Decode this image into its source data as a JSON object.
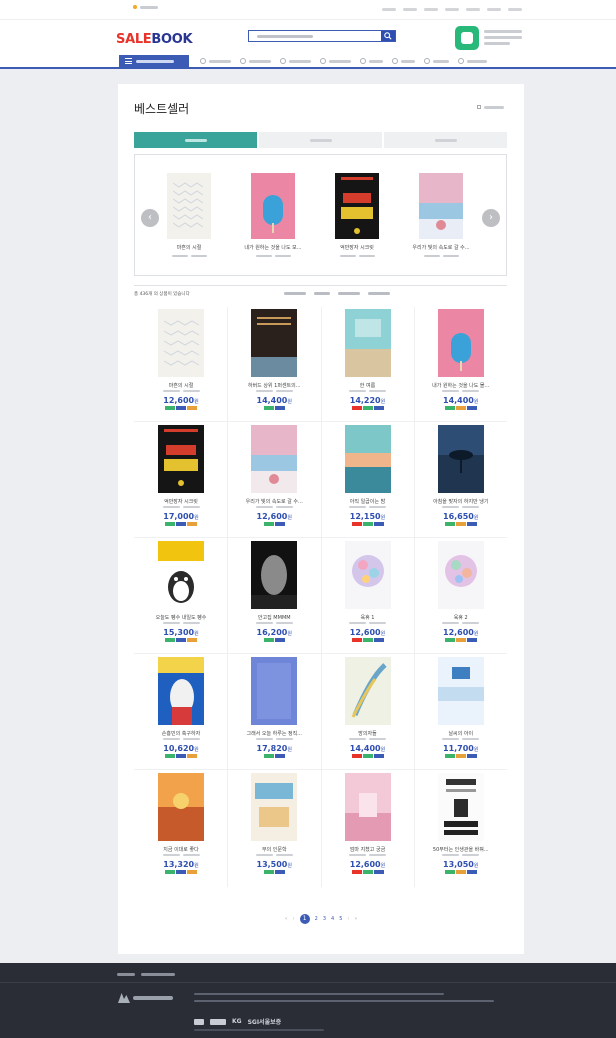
{
  "header": {
    "logo_left": "SALE",
    "logo_right": "BOOK"
  },
  "page": {
    "title": "베스트셀러"
  },
  "slider": [
    {
      "title": "마흔의 시절"
    },
    {
      "title": "내가 원하는 것을 나도 모..."
    },
    {
      "title": "억만장자 시크릿"
    },
    {
      "title": "우리가 빛의 속도로 갈 수..."
    }
  ],
  "filter": {
    "count": "총 436개 의 상품이 있습니다"
  },
  "products": [
    {
      "title": "마흔의 시절",
      "price": "12,600",
      "won": "원",
      "cover": "mahun"
    },
    {
      "title": "하버드 상위 1퍼센트의...",
      "price": "14,400",
      "won": "원",
      "cover": "dark"
    },
    {
      "title": "한 여름",
      "price": "14,220",
      "won": "원",
      "cover": "sea"
    },
    {
      "title": "내가 원하는 것을 나도 몰...",
      "price": "14,400",
      "won": "원",
      "cover": "pink"
    },
    {
      "title": "억만장자 시크릿",
      "price": "17,000",
      "won": "원",
      "cover": "secret"
    },
    {
      "title": "우리가 빛의 속도로 갈 수...",
      "price": "12,600",
      "won": "원",
      "cover": "light"
    },
    {
      "title": "아직 일곱이는 밤",
      "price": "12,150",
      "won": "원",
      "cover": "sunset"
    },
    {
      "title": "아침을 맞자의 하지만 냉기",
      "price": "16,650",
      "won": "원",
      "cover": "umbrella"
    },
    {
      "title": "오늘도 펭수 내일도 펭수",
      "price": "15,300",
      "won": "원",
      "cover": "pengsoo"
    },
    {
      "title": "안고집 MMMM",
      "price": "16,200",
      "won": "원",
      "cover": "portrait"
    },
    {
      "title": "육휴 1",
      "price": "12,600",
      "won": "원",
      "cover": "color1"
    },
    {
      "title": "육휴 2",
      "price": "12,600",
      "won": "원",
      "cover": "color2"
    },
    {
      "title": "손흥민의 축구하자",
      "price": "10,620",
      "won": "원",
      "cover": "soccer"
    },
    {
      "title": "그래서 오늘 하루는 정직...",
      "price": "17,820",
      "won": "원",
      "cover": "blue"
    },
    {
      "title": "방의자들",
      "price": "14,400",
      "won": "원",
      "cover": "feather"
    },
    {
      "title": "날씨의 아이",
      "price": "11,700",
      "won": "원",
      "cover": "sky"
    },
    {
      "title": "지금 이대로 좋다",
      "price": "13,320",
      "won": "원",
      "cover": "orange"
    },
    {
      "title": "부의 인문학",
      "price": "13,500",
      "won": "원",
      "cover": "wealth"
    },
    {
      "title": "엄마 지쳤고 궁금",
      "price": "12,600",
      "won": "원",
      "cover": "mom"
    },
    {
      "title": "50부터는 인생관을 바꿔...",
      "price": "13,050",
      "won": "원",
      "cover": "change"
    }
  ],
  "pagination": {
    "prev2": "«",
    "prev": "‹",
    "pages": [
      "1",
      "2",
      "3",
      "4",
      "5"
    ],
    "next": "›",
    "next2": "»"
  },
  "footer": {
    "pay_kg": "KG",
    "pay_sgi": "SGI서울보증"
  },
  "colors": {
    "brand_blue": "#3b5bb5",
    "sale_red": "#e8332a",
    "tab_active": "#3aa39a",
    "footer_bg": "#2a2d36"
  }
}
